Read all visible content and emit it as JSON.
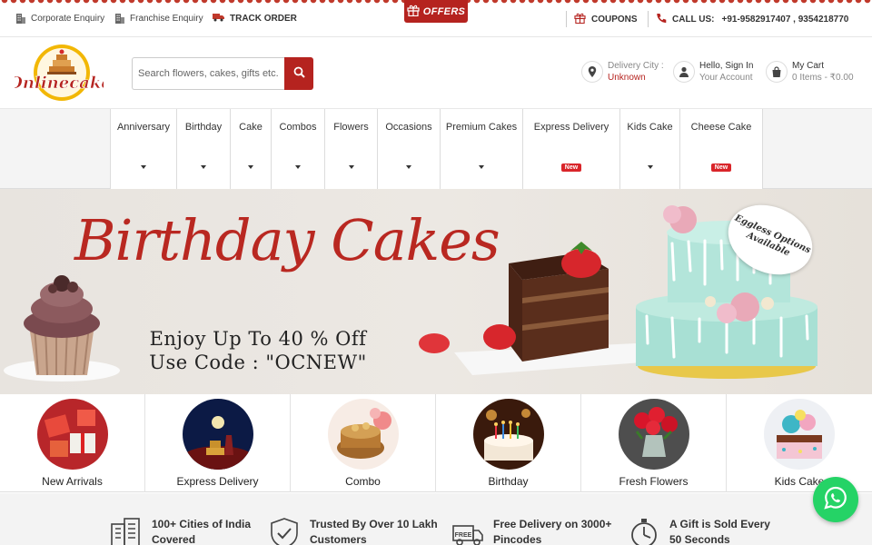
{
  "topbar": {
    "corporate_enquiry": "Corporate Enquiry",
    "franchise_enquiry": "Franchise Enquiry",
    "track_order": "TRACK ORDER",
    "offers": "OFFERS",
    "coupons": "COUPONS",
    "call_us_label": "CALL US:",
    "phone_numbers": "+91-9582917407 , 9354218770"
  },
  "header": {
    "logo_text": "Onlinecake",
    "search_placeholder": "Search flowers, cakes, gifts etc.",
    "delivery_city_label": "Delivery City :",
    "delivery_city_value": "Unknown",
    "account_line1": "Hello, Sign In",
    "account_line2": "Your Account",
    "cart_line1": "My Cart",
    "cart_line2": "0 Items - ₹0.00"
  },
  "nav": {
    "items": [
      {
        "label": "Anniversary",
        "marker": "caret"
      },
      {
        "label": "Birthday",
        "marker": "caret"
      },
      {
        "label": "Cake",
        "marker": "caret"
      },
      {
        "label": "Combos",
        "marker": "caret"
      },
      {
        "label": "Flowers",
        "marker": "caret"
      },
      {
        "label": "Occasions",
        "marker": "caret"
      },
      {
        "label": "Premium Cakes",
        "marker": "caret"
      },
      {
        "label": "Express Delivery",
        "marker": "new",
        "badge": "New"
      },
      {
        "label": "Kids Cake",
        "marker": "caret"
      },
      {
        "label": "Cheese Cake",
        "marker": "new",
        "badge": "New"
      }
    ]
  },
  "banner": {
    "title": "Birthday Cakes",
    "offer_line1": "Enjoy Up To 40 % Off",
    "offer_line2": "Use Code : \"OCNEW\"",
    "tag_line1": "Eggless Options",
    "tag_line2": "Available"
  },
  "categories": [
    {
      "label": "New Arrivals",
      "icon": "gift-boxes-image"
    },
    {
      "label": "Express Delivery",
      "icon": "night-delivery-image"
    },
    {
      "label": "Combo",
      "icon": "combo-cake-flowers-image"
    },
    {
      "label": "Birthday",
      "icon": "birthday-candle-cake-image"
    },
    {
      "label": "Fresh Flowers",
      "icon": "red-roses-vase-image"
    },
    {
      "label": "Kids Cake",
      "icon": "kids-cake-image"
    }
  ],
  "features": [
    {
      "line1": "100+ Cities of India",
      "line2": "Covered",
      "icon": "city-buildings-icon"
    },
    {
      "line1": "Trusted By Over 10 Lakh",
      "line2": "Customers",
      "icon": "shield-check-icon"
    },
    {
      "line1": "Free Delivery on 3000+",
      "line2": "Pincodes",
      "icon": "free-delivery-truck-icon"
    },
    {
      "line1": "A Gift is Sold Every",
      "line2": "50 Seconds",
      "icon": "stopwatch-icon"
    }
  ],
  "colors": {
    "brand_red": "#b5231f",
    "new_badge": "#d9252a",
    "whatsapp_green": "#25d366"
  }
}
